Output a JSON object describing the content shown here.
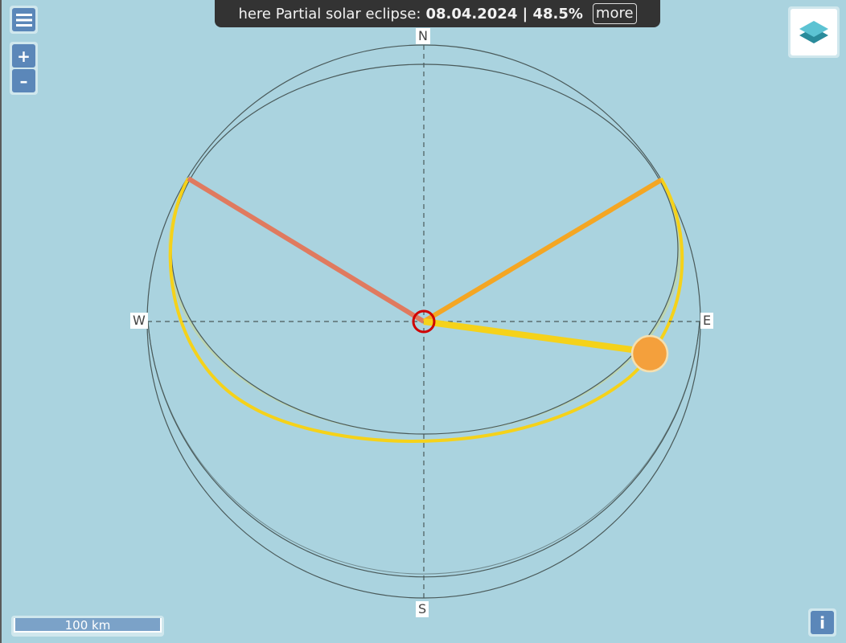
{
  "banner": {
    "prefix": "here Partial solar eclipse:",
    "date_pct": "08.04.2024 | 48.5%",
    "more_label": "more"
  },
  "controls": {
    "menu_icon": "hamburger-menu-icon",
    "zoom_in": "+",
    "zoom_out": "–",
    "layers_icon": "layers-icon",
    "info": "i"
  },
  "compass": {
    "north": "N",
    "south": "S",
    "east": "E",
    "west": "W"
  },
  "scale": {
    "label": "100 km"
  },
  "colors": {
    "water": "#aad3df",
    "shadow_area": "#bcd5b0",
    "sunset_line": "#e07a5f",
    "sunrise_line": "#f4a623",
    "sun_line": "#f5d21a",
    "sun_marker": "#f4a03c",
    "location_marker": "#d00000",
    "ui_dark": "#333333",
    "ui_button": "#5b87b9"
  }
}
